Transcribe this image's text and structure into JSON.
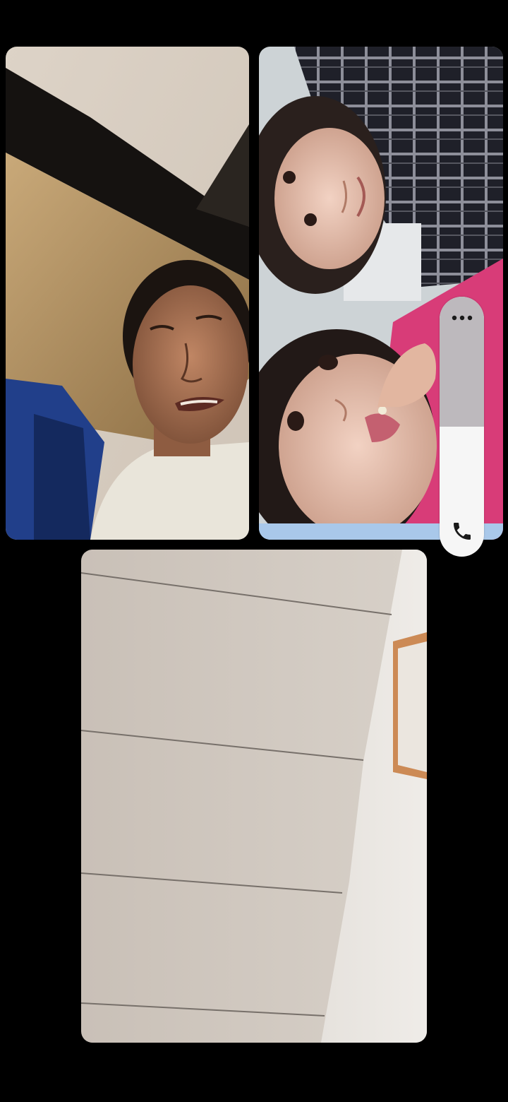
{
  "call": {
    "participants": [
      {
        "id": "participant-1",
        "video": "man-in-white-shirt"
      },
      {
        "id": "participant-2",
        "video": "two-children"
      },
      {
        "id": "participant-3",
        "video": "wall-view"
      }
    ],
    "controls": {
      "more_icon": "more-horizontal-icon",
      "call_icon": "phone-icon",
      "colors": {
        "pill_top": "#bdb9bd",
        "pill_bottom": "#f6f6f6",
        "icon": "#1a1a1a"
      }
    }
  }
}
